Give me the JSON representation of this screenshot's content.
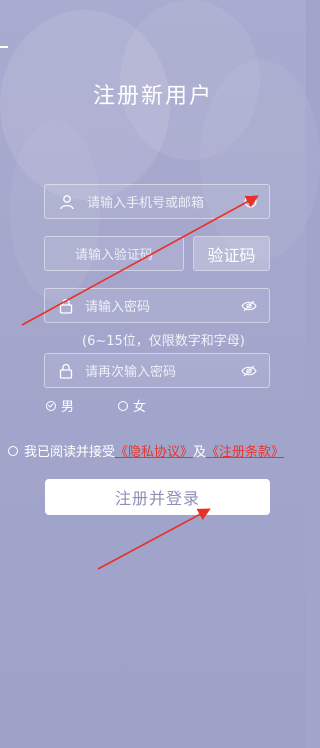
{
  "page": {
    "title": "注册新用户"
  },
  "form": {
    "account_placeholder": "请输入手机号或邮箱",
    "code_placeholder": "请输入验证码",
    "get_code_label": "验证码",
    "password_placeholder": "请输入密码",
    "password_hint": "(6~15位，仅限数字和字母)",
    "confirm_password_placeholder": "请再次输入密码",
    "gender": {
      "male_label": "男",
      "female_label": "女",
      "selected": "男"
    },
    "agreement": {
      "prefix": "我已阅读并接受",
      "privacy_link": "《隐私协议》",
      "connector": "及",
      "terms_link": "《注册条款》",
      "checked": false
    },
    "submit_label": "注册并登录"
  },
  "colors": {
    "background": "#a2a4cb",
    "link": "#e5372e",
    "annotation_arrow": "#e8302a",
    "button_text": "#8e90b6"
  },
  "icons": [
    "user-icon",
    "clear-icon",
    "lock-icon",
    "eye-off-icon",
    "radio-icon"
  ]
}
